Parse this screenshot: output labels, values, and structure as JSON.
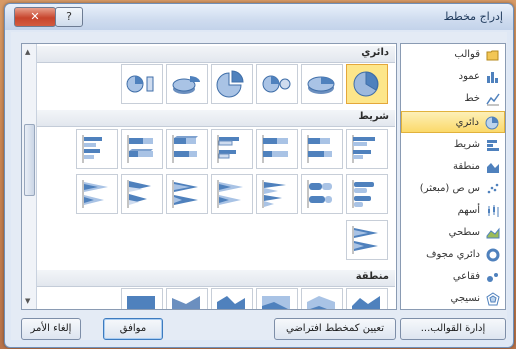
{
  "dialog": {
    "title": "إدراج مخطط",
    "close_label": "✕",
    "help_label": "?"
  },
  "categories": [
    {
      "label": "قوالب",
      "icon": "folder-icon"
    },
    {
      "label": "عمود",
      "icon": "column-chart-icon"
    },
    {
      "label": "خط",
      "icon": "line-chart-icon"
    },
    {
      "label": "دائري",
      "icon": "pie-chart-icon",
      "selected": true
    },
    {
      "label": "شريط",
      "icon": "bar-chart-icon"
    },
    {
      "label": "منطقة",
      "icon": "area-chart-icon"
    },
    {
      "label": "س ص (مبعثر)",
      "icon": "scatter-chart-icon"
    },
    {
      "label": "أسهم",
      "icon": "stock-chart-icon"
    },
    {
      "label": "سطحي",
      "icon": "surface-chart-icon"
    },
    {
      "label": "دائري مجوف",
      "icon": "doughnut-chart-icon"
    },
    {
      "label": "فقاعي",
      "icon": "bubble-chart-icon"
    },
    {
      "label": "نسيجي",
      "icon": "radar-chart-icon"
    }
  ],
  "sections": {
    "pie": "دائري",
    "bar": "شريط",
    "area": "منطقة"
  },
  "buttons": {
    "manage_templates": "إدارة القوالب...",
    "set_default": "تعيين كمخطط افتراضي",
    "ok": "موافق",
    "cancel": "إلغاء الأمر"
  },
  "colors": {
    "selection": "#fbd96a",
    "accent_blue": "#4f81bd"
  }
}
